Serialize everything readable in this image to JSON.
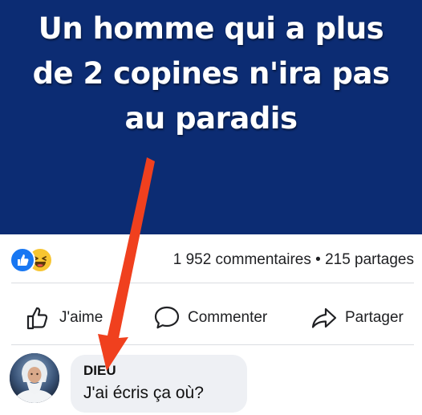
{
  "banner": {
    "line1": "Un homme qui a plus",
    "line2": "de 2 copines n'ira pas",
    "line3": "au paradis",
    "background_color": "#0c2c73"
  },
  "reactions": {
    "icons": [
      "like-icon",
      "haha-icon"
    ],
    "stats": "1 952 commentaires • 215 partages"
  },
  "actions": {
    "like_label": "J'aime",
    "comment_label": "Commenter",
    "share_label": "Partager"
  },
  "comment": {
    "author": "DIEU",
    "text": "J'ai écris ça où?"
  },
  "colors": {
    "arrow": "#f0401e",
    "like_blue": "#1877f2",
    "haha_yellow": "#f7c531",
    "bubble_bg": "#eef0f4"
  }
}
